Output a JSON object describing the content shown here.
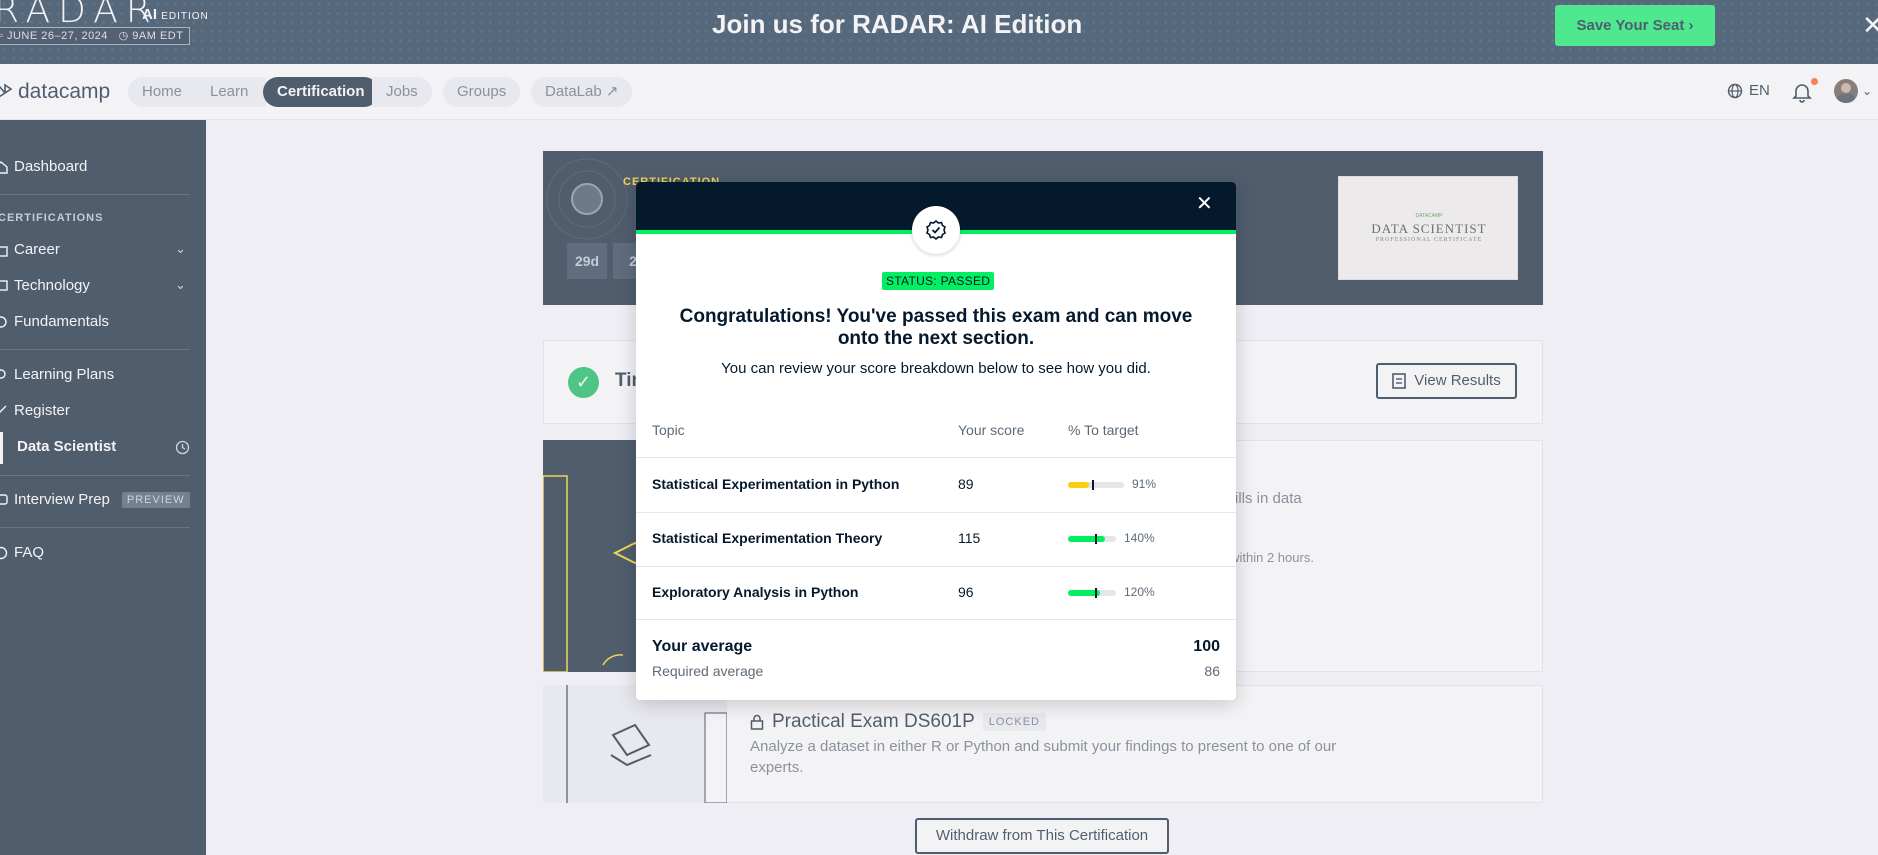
{
  "banner": {
    "logo": "RADAR",
    "edition_main": "AI",
    "edition_sub": "EDITION",
    "date": "JUNE 26–27, 2024",
    "time": "9AM EDT",
    "title": "Join us for RADAR: AI Edition",
    "cta_label": "Save Your Seat",
    "close_icon": "close-icon"
  },
  "topnav": {
    "logo": "datacamp",
    "items": [
      {
        "label": "Home",
        "active": false
      },
      {
        "label": "Learn",
        "active": false
      },
      {
        "label": "Certification",
        "active": true
      },
      {
        "label": "Jobs",
        "active": false
      },
      {
        "label": "Groups",
        "active": false
      },
      {
        "label": "DataLab",
        "active": false
      }
    ],
    "language": "EN"
  },
  "sidebar": {
    "dashboard": "Dashboard",
    "section_heading": "CERTIFICATIONS",
    "career": "Career",
    "technology": "Technology",
    "fundamentals": "Fundamentals",
    "learning_plans": "Learning Plans",
    "register": "Register",
    "data_scientist": "Data Scientist",
    "interview_prep": "Interview Prep",
    "preview_badge": "PREVIEW",
    "faq": "FAQ"
  },
  "main": {
    "cert_label": "CERTIFICATION",
    "countdown": [
      "29d",
      "2"
    ],
    "cert_image_brand": "DATACAMP",
    "cert_image_title": "DATA SCIENTIST",
    "cert_image_sub": "PROFESSIONAL CERTIFICATE",
    "timed_title": "Tim",
    "view_results": "View Results",
    "exam_text1": "skills in data",
    "exam_text2": "s within 2 hours.",
    "practical_title": "Practical Exam DS601P",
    "locked": "LOCKED",
    "practical_desc": "Analyze a dataset in either R or Python and submit your findings to present to one of our experts.",
    "withdraw": "Withdraw from This Certification"
  },
  "modal": {
    "status": "STATUS: PASSED",
    "title": "Congratulations! You've passed this exam and can move onto the next section.",
    "subtitle": "You can review your score breakdown below to see how you did.",
    "headers": {
      "topic": "Topic",
      "score": "Your score",
      "target": "% To target"
    },
    "rows": [
      {
        "topic": "Statistical Experimentation in Python",
        "score": "89",
        "pct_label": "91%",
        "pct": 91,
        "color": "#fcce0d"
      },
      {
        "topic": "Statistical Experimentation Theory",
        "score": "115",
        "pct_label": "140%",
        "pct": 140,
        "color": "#03ef62"
      },
      {
        "topic": "Exploratory Analysis in Python",
        "score": "96",
        "pct_label": "120%",
        "pct": 120,
        "color": "#03ef62"
      }
    ],
    "your_average_label": "Your average",
    "your_average": "100",
    "required_average_label": "Required average",
    "required_average": "86"
  }
}
